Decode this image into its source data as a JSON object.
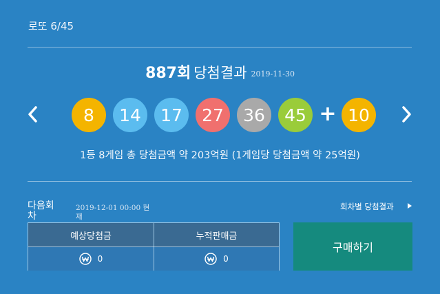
{
  "header": {
    "title": "로또 6/45"
  },
  "draw": {
    "round": "887회",
    "label": "당첨결과",
    "date": "2019-11-30",
    "numbers": [
      {
        "value": "8",
        "color": "#f4b400"
      },
      {
        "value": "14",
        "color": "#5bbcef"
      },
      {
        "value": "17",
        "color": "#5bbcef"
      },
      {
        "value": "27",
        "color": "#f0706e"
      },
      {
        "value": "36",
        "color": "#a9a9a9"
      },
      {
        "value": "45",
        "color": "#9acc3a"
      }
    ],
    "plus": "+",
    "bonus": {
      "value": "10",
      "color": "#f4b400"
    },
    "prize_text": "1등 8게임 총 당첨금액 약 203억원 (1게임당 당첨금액 약 25억원)"
  },
  "next": {
    "label": "다음회차",
    "datetime": "2019-12-01 00:00 현재",
    "history_link": "회차별 당첨결과",
    "table": {
      "headers": [
        "예상당첨금",
        "누적판매금"
      ],
      "values": [
        "0",
        "0"
      ]
    },
    "buy_button": "구매하기"
  },
  "icons": {
    "prev": "chevron-left-icon",
    "next": "chevron-right-icon",
    "won": "won-coin-icon",
    "history_arrow": "caret-right-icon"
  }
}
